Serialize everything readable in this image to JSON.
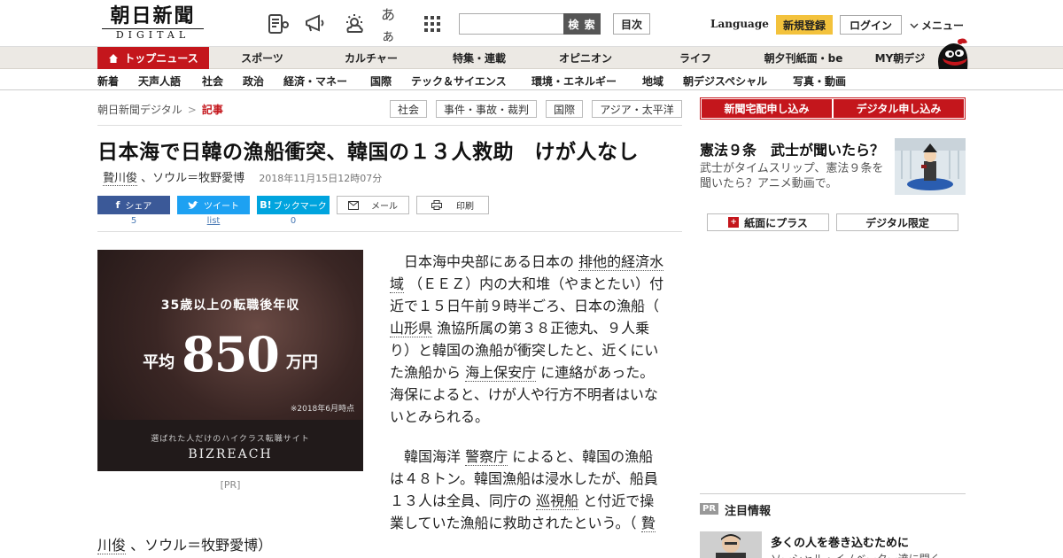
{
  "header": {
    "logo_main": "朝日新聞",
    "logo_sub": "DIGITAL",
    "icon_aa": "あぁ",
    "search_placeholder": "",
    "search_button": "検 索",
    "toc_button": "目次",
    "language": "Language",
    "register": "新規登録",
    "login": "ログイン",
    "menu": "メニュー"
  },
  "nav1": {
    "top_news": "トップニュース",
    "items": [
      "スポーツ",
      "カルチャー",
      "特集・連載",
      "オピニオン",
      "ライフ",
      "朝夕刊紙面・be",
      "MY朝デジ"
    ]
  },
  "nav2": {
    "items": [
      "新着",
      "天声人語",
      "社会",
      "政治",
      "経済・マネー",
      "国際",
      "テック＆サイエンス",
      "環境・エネルギー",
      "地域",
      "朝デジスペシャル",
      "写真・動画"
    ]
  },
  "breadcrumb": {
    "home": "朝日新聞デジタル",
    "sep": ">",
    "current": "記事"
  },
  "tags": [
    "社会",
    "事件・事故・裁判",
    "国際",
    "アジア・太平洋"
  ],
  "subscribe": {
    "home_delivery": "新聞宅配申し込み",
    "digital": "デジタル申し込み"
  },
  "article": {
    "headline": "日本海で日韓の漁船衝突、韓国の１３人救助　けが人なし",
    "author1": "贄川俊",
    "byline_rest": "、ソウル＝牧野愛博",
    "date": "2018年11月15日12時07分",
    "p1_a": "日本海中央部にある日本の",
    "p1_link1": "排他的経済水域",
    "p1_b": "（ＥＥＺ）内の大和堆（やまとたい）付近で１５日午前９時半ごろ、日本の漁船（",
    "p1_link2": "山形県",
    "p1_c": "漁協所属の第３８正徳丸、９人乗り）と韓国の漁船が衝突したと、近くにいた漁船から",
    "p1_link3": "海上保安庁",
    "p1_d": "に連絡があった。海保によると、けが人や行方不明者はいないとみられる。",
    "p2_a": "韓国海洋",
    "p2_link1": "警察庁",
    "p2_b": "によると、韓国の漁船は４８トン。韓国漁船は浸水したが、船員１３人は全員、同庁の",
    "p2_link2": "巡視船",
    "p2_c": "と付近で操業していた漁船に救助されたという。（",
    "p2_link3a": "贄",
    "tail_link": "川俊",
    "tail_rest": "、ソウル＝牧野愛博）"
  },
  "social": {
    "share": "シェア",
    "share_count": "5",
    "tweet": "ツイート",
    "tweet_count": "list",
    "bookmark": "ブックマーク",
    "bookmark_count": "0",
    "mail": "メール",
    "print": "印刷"
  },
  "ad": {
    "line1": "35歳以上の転職後年収",
    "pre": "平均",
    "amount": "850",
    "unit": "万円",
    "note": "※2018年6月時点",
    "tagline": "選ばれた人だけのハイクラス転職サイト",
    "brand": "BIZREACH",
    "pr_label": "[PR]"
  },
  "sidebar": {
    "promo_title": "憲法９条　武士が聞いたら？",
    "promo_desc": "武士がタイムスリップ、憲法９条を聞いたら？アニメ動画で。",
    "paper_plus": "紙面にプラス",
    "paper_plus_icon_text": "+",
    "digital_only": "デジタル限定",
    "pr_badge": "PR",
    "attention": "注目情報",
    "item_title": "多くの人を巻き込むために",
    "item_sub": "ソーシャル・イノベーター達に聞く"
  },
  "colors": {
    "brand_red": "#c4161c",
    "register_yellow": "#f3c23c",
    "facebook": "#3b5998",
    "twitter": "#1da1f2",
    "hatena": "#00a4de"
  }
}
